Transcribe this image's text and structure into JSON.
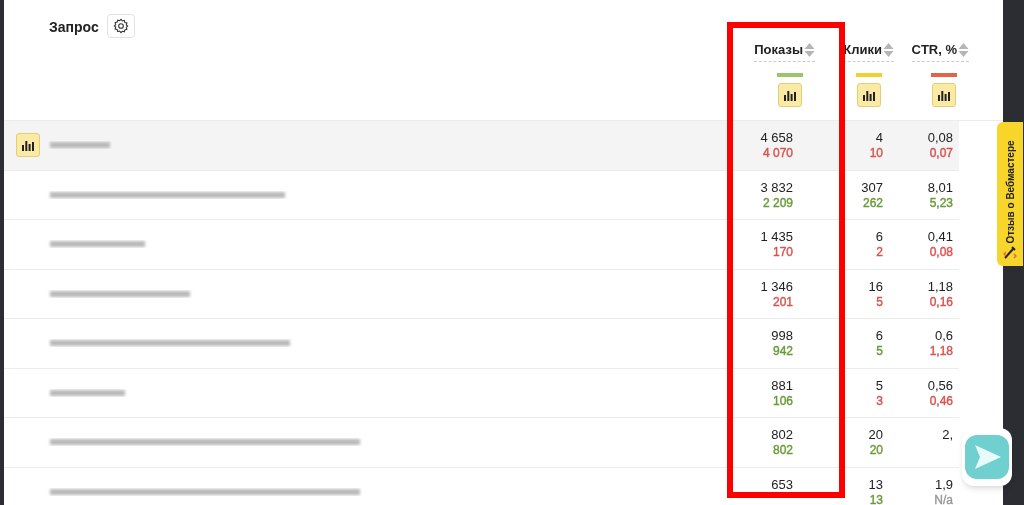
{
  "header": {
    "query_label": "Запрос",
    "columns": [
      {
        "label": "Показы",
        "color": "#9cc46a"
      },
      {
        "label": "Клики",
        "color": "#f2d02e"
      },
      {
        "label": "CTR, %",
        "color": "#e0664b"
      }
    ]
  },
  "rows": [
    {
      "selected": true,
      "cells": [
        {
          "value": "4 658",
          "sub": "4 070",
          "color": "#d9534f"
        },
        {
          "value": "4",
          "sub": "10",
          "color": "#d9534f"
        },
        {
          "value": "0,08",
          "sub": "0,07",
          "color": "#d9534f"
        }
      ]
    },
    {
      "selected": false,
      "cells": [
        {
          "value": "3 832",
          "sub": "2 209",
          "color": "#6a9a3a"
        },
        {
          "value": "307",
          "sub": "262",
          "color": "#6a9a3a"
        },
        {
          "value": "8,01",
          "sub": "5,23",
          "color": "#6a9a3a"
        }
      ]
    },
    {
      "selected": false,
      "cells": [
        {
          "value": "1 435",
          "sub": "170",
          "color": "#d9534f"
        },
        {
          "value": "6",
          "sub": "2",
          "color": "#d9534f"
        },
        {
          "value": "0,41",
          "sub": "0,08",
          "color": "#d9534f"
        }
      ]
    },
    {
      "selected": false,
      "cells": [
        {
          "value": "1 346",
          "sub": "201",
          "color": "#d9534f"
        },
        {
          "value": "16",
          "sub": "5",
          "color": "#d9534f"
        },
        {
          "value": "1,18",
          "sub": "0,16",
          "color": "#d9534f"
        }
      ]
    },
    {
      "selected": false,
      "cells": [
        {
          "value": "998",
          "sub": "942",
          "color": "#6a9a3a"
        },
        {
          "value": "6",
          "sub": "5",
          "color": "#6a9a3a"
        },
        {
          "value": "0,6",
          "sub": "1,18",
          "color": "#d9534f"
        }
      ]
    },
    {
      "selected": false,
      "cells": [
        {
          "value": "881",
          "sub": "106",
          "color": "#6a9a3a"
        },
        {
          "value": "5",
          "sub": "3",
          "color": "#d9534f"
        },
        {
          "value": "0,56",
          "sub": "0,46",
          "color": "#d9534f"
        }
      ]
    },
    {
      "selected": false,
      "cells": [
        {
          "value": "802",
          "sub": "802",
          "color": "#6a9a3a"
        },
        {
          "value": "20",
          "sub": "20",
          "color": "#6a9a3a"
        },
        {
          "value": "2,"
        }
      ]
    },
    {
      "selected": false,
      "cells": [
        {
          "value": "653"
        },
        {
          "value": "13",
          "sub": "13",
          "color": "#6a9a3a"
        },
        {
          "value": "1,9",
          "sub": "N/a",
          "color": "#999999"
        }
      ]
    }
  ],
  "feedback_tab": {
    "label": "Отзыв о Вебмастере"
  }
}
